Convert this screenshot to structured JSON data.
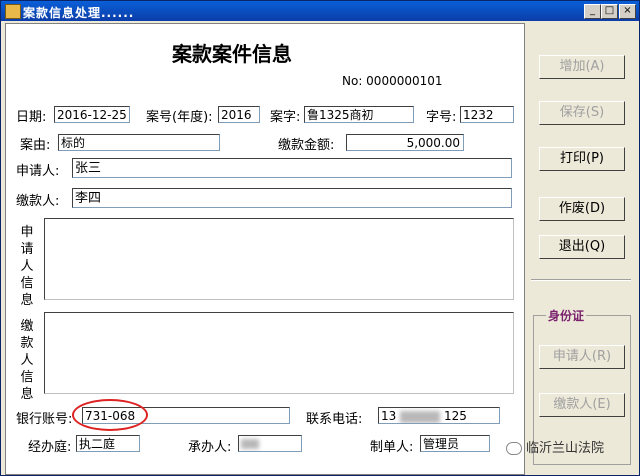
{
  "window": {
    "title": "案款信息处理......",
    "controls": [
      "_",
      "□",
      "×"
    ]
  },
  "form": {
    "heading": "案款案件信息",
    "number": "No: 0000000101",
    "date": {
      "label": "日期:",
      "value": "2016-12-25"
    },
    "case_year": {
      "label": "案号(年度):",
      "value": "2016"
    },
    "case_word": {
      "label": "案字:",
      "value": "鲁1325商初"
    },
    "case_no": {
      "label": "字号:",
      "value": "1232"
    },
    "cause": {
      "label": "案由:",
      "value": "标的"
    },
    "amount": {
      "label": "缴款金额:",
      "value": "5,000.00"
    },
    "applicant": {
      "label": "申请人:",
      "value": "张三"
    },
    "payer": {
      "label": "缴款人:",
      "value": "李四"
    },
    "applicant_info_label": [
      "申",
      "请",
      "人",
      "信",
      "息"
    ],
    "payer_info_label": [
      "缴",
      "款",
      "人",
      "信",
      "息"
    ],
    "bank_account": {
      "label": "银行账号:",
      "value": "731-068"
    },
    "phone": {
      "label": "联系电话:",
      "value_start": "13",
      "value_end": "125"
    },
    "court": {
      "label": "经办庭:",
      "value": "执二庭"
    },
    "handler": {
      "label": "承办人:",
      "value": ""
    },
    "maker": {
      "label": "制单人:",
      "value": "管理员"
    }
  },
  "buttons": {
    "add": "增加(A)",
    "save": "保存(S)",
    "print": "打印(P)",
    "void": "作废(D)",
    "exit": "退出(Q)"
  },
  "identity_group": {
    "title": "身份证",
    "applicant_btn": "申请人(R)",
    "payer_btn": "缴款人(E)"
  },
  "watermark": "临沂兰山法院",
  "colors": {
    "titlebar": "#0b3da8",
    "highlight_circle": "#dd2222",
    "group_title": "#7a1f6e"
  }
}
